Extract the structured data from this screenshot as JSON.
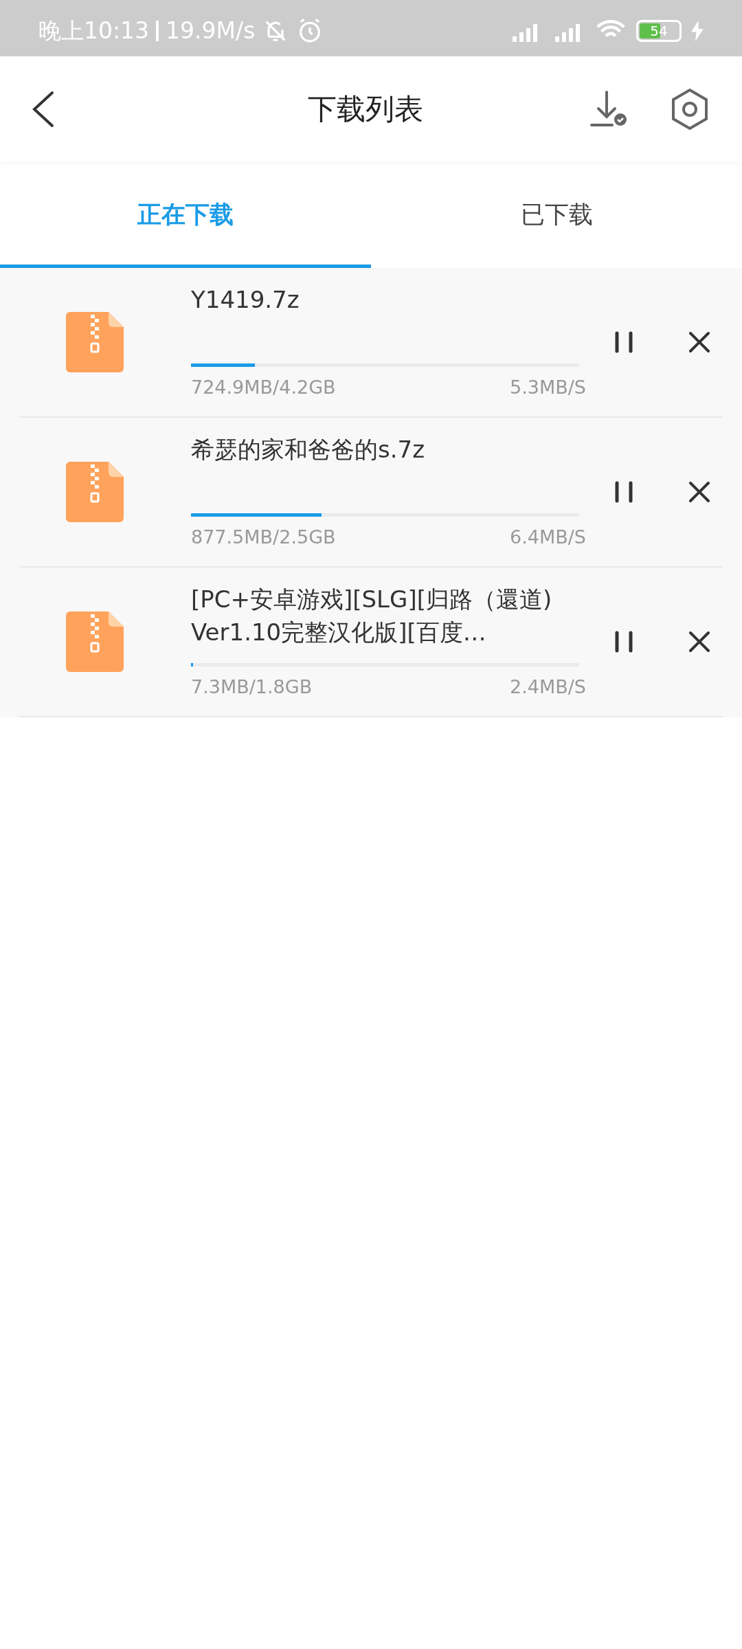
{
  "status_bar": {
    "time": "晚上10:13",
    "speed": "19.9M/s",
    "battery": "54"
  },
  "header": {
    "title": "下载列表"
  },
  "tabs": [
    {
      "label": "正在下载",
      "selected": true
    },
    {
      "label": "已下载",
      "selected": false
    }
  ],
  "downloads": [
    {
      "name": "Y1419.7z",
      "level": 0.165,
      "size": "724.9MB/4.2GB",
      "speed": "5.3MB/S"
    },
    {
      "name": "希瑟的家和爸爸的s.7z",
      "level": 0.336,
      "size": "877.5MB/2.5GB",
      "speed": "6.4MB/S"
    },
    {
      "name": "[PC+安卓游戏][SLG][归路（還道) Ver1.10完整汉化版][百度…",
      "level": 0.005,
      "size": "7.3MB/1.8GB",
      "speed": "2.4MB/S"
    }
  ]
}
